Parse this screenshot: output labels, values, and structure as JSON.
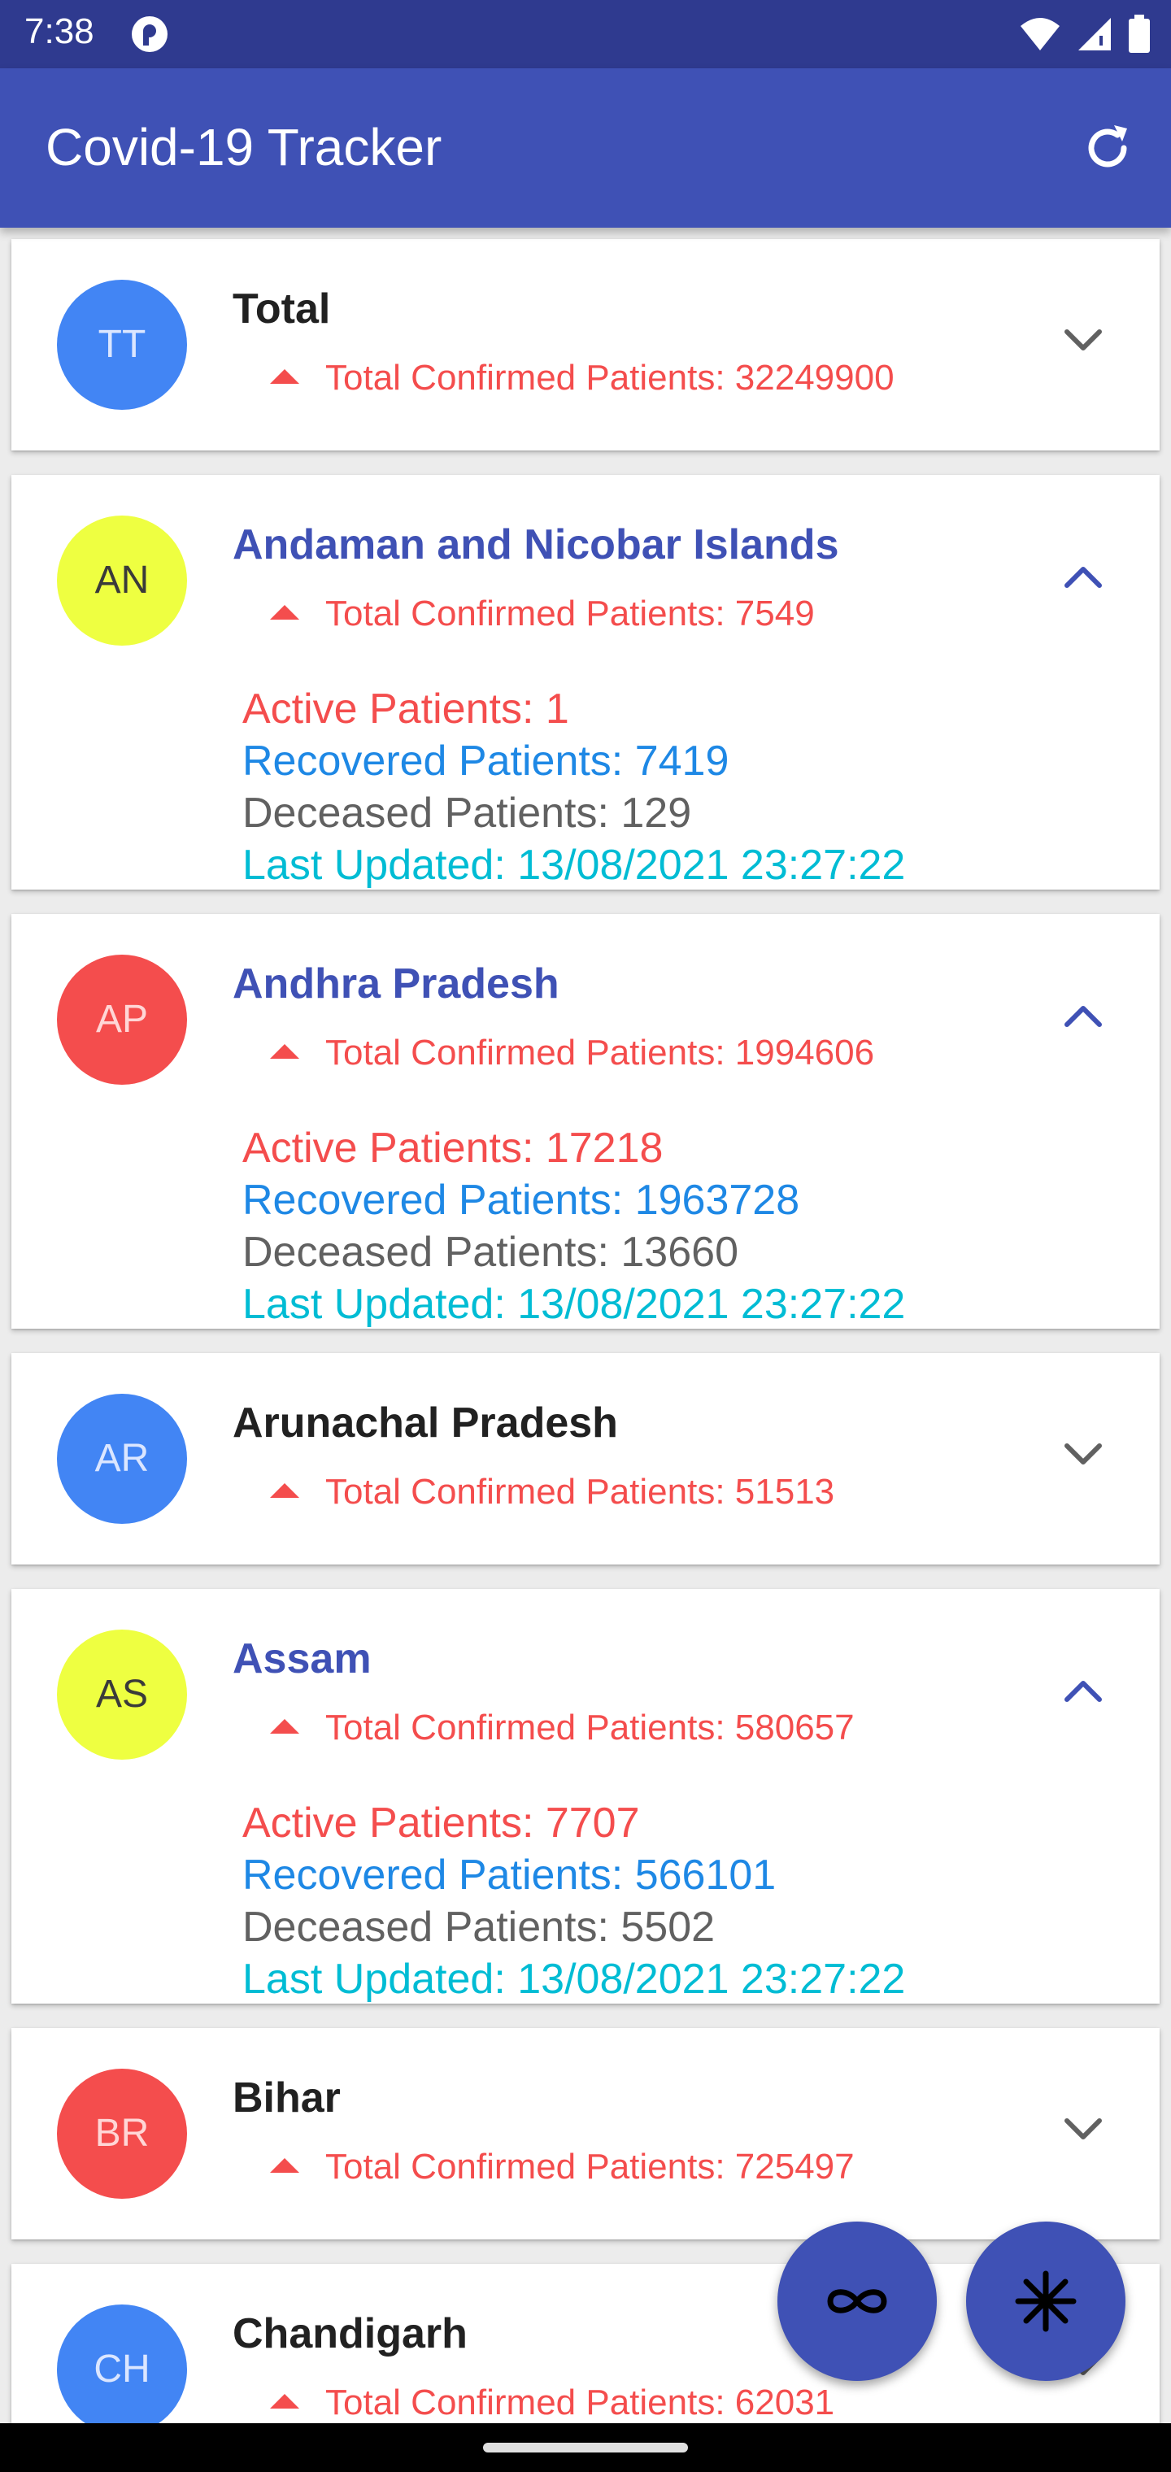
{
  "status_bar": {
    "time": "7:38"
  },
  "app_bar": {
    "title": "Covid-19 Tracker"
  },
  "labels": {
    "confirmed_prefix": "Total Confirmed Patients: ",
    "active_prefix": "Active Patients: ",
    "recovered_prefix": "Recovered Patients: ",
    "deceased_prefix": "Deceased Patients: ",
    "updated_prefix": "Last Updated: "
  },
  "colors": {
    "primary": "#3f51b5",
    "avatar_blue": "#4285f4",
    "avatar_yellow": "#eeff41",
    "avatar_red": "#f44d4d",
    "confirmed_red": "#f44d4d",
    "recovered_blue": "#1e88e5",
    "updated_cyan": "#00bcd4"
  },
  "states": [
    {
      "initials": "TT",
      "name": "Total",
      "confirmed": "32249900",
      "expanded": false,
      "avatar_color": "#4285f4",
      "avatar_text_color": "#dbe6ff"
    },
    {
      "initials": "AN",
      "name": "Andaman and Nicobar Islands",
      "confirmed": "7549",
      "expanded": true,
      "avatar_color": "#eeff41",
      "avatar_text_color": "#3a3a3a",
      "active": "1",
      "recovered": "7419",
      "deceased": "129",
      "last_updated": "13/08/2021 23:27:22"
    },
    {
      "initials": "AP",
      "name": "Andhra Pradesh",
      "confirmed": "1994606",
      "expanded": true,
      "avatar_color": "#f44d4d",
      "avatar_text_color": "#ffd6d6",
      "active": "17218",
      "recovered": "1963728",
      "deceased": "13660",
      "last_updated": "13/08/2021 23:27:22"
    },
    {
      "initials": "AR",
      "name": "Arunachal Pradesh",
      "confirmed": "51513",
      "expanded": false,
      "avatar_color": "#4285f4",
      "avatar_text_color": "#dbe6ff"
    },
    {
      "initials": "AS",
      "name": "Assam",
      "confirmed": "580657",
      "expanded": true,
      "avatar_color": "#eeff41",
      "avatar_text_color": "#3a3a3a",
      "active": "7707",
      "recovered": "566101",
      "deceased": "5502",
      "last_updated": "13/08/2021 23:27:22"
    },
    {
      "initials": "BR",
      "name": "Bihar",
      "confirmed": "725497",
      "expanded": false,
      "avatar_color": "#f44d4d",
      "avatar_text_color": "#ffd6d6"
    },
    {
      "initials": "CH",
      "name": "Chandigarh",
      "confirmed": "62031",
      "expanded": false,
      "avatar_color": "#4285f4",
      "avatar_text_color": "#dbe6ff"
    }
  ],
  "fabs": [
    {
      "icon": "infinity-icon"
    },
    {
      "icon": "snowflake-icon"
    }
  ]
}
